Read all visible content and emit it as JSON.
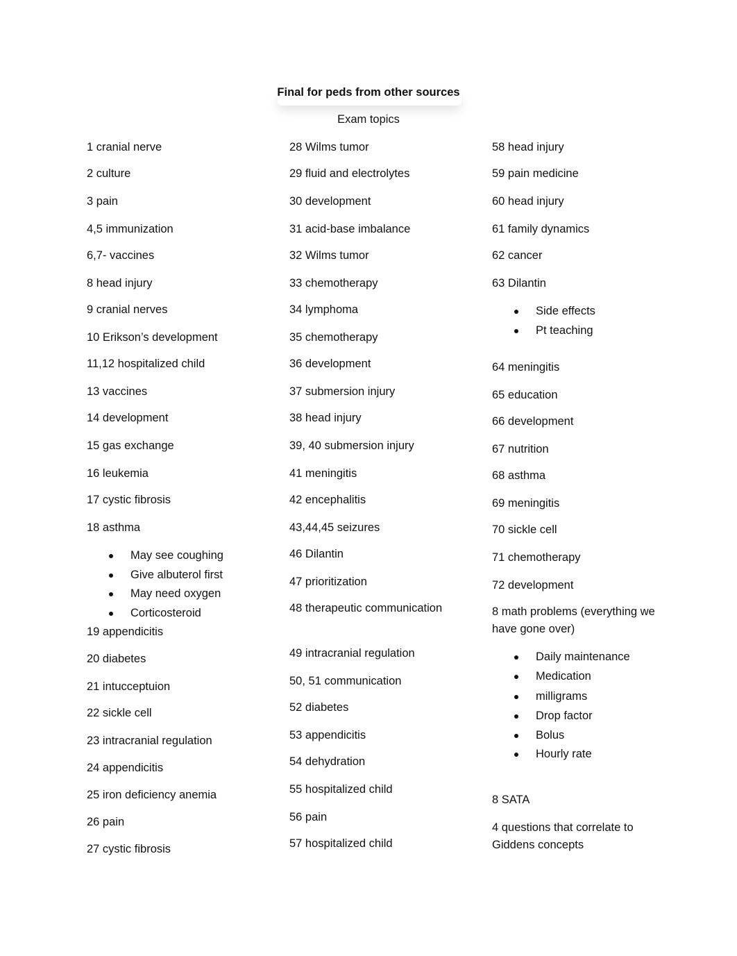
{
  "document": {
    "title": "Final for peds from other sources",
    "subtitle": "Exam topics"
  },
  "columns": [
    {
      "items": [
        {
          "type": "item",
          "text": "1 cranial nerve"
        },
        {
          "type": "item",
          "text": "2 culture"
        },
        {
          "type": "item",
          "text": "3 pain"
        },
        {
          "type": "item",
          "text": "4,5 immunization"
        },
        {
          "type": "item",
          "text": "6,7- vaccines"
        },
        {
          "type": "item",
          "text": "8 head injury"
        },
        {
          "type": "item",
          "text": "9 cranial nerves"
        },
        {
          "type": "item",
          "text": "10 Erikson’s development"
        },
        {
          "type": "item",
          "text": "11,12 hospitalized child"
        },
        {
          "type": "item",
          "text": "13 vaccines"
        },
        {
          "type": "item",
          "text": "14 development"
        },
        {
          "type": "item",
          "text": "15 gas exchange"
        },
        {
          "type": "item",
          "text": "16 leukemia"
        },
        {
          "type": "item",
          "text": "17 cystic fibrosis"
        },
        {
          "type": "item",
          "text": "18 asthma"
        },
        {
          "type": "bullet",
          "text": "May see coughing"
        },
        {
          "type": "bullet",
          "text": "Give albuterol first"
        },
        {
          "type": "bullet",
          "text": "May need oxygen"
        },
        {
          "type": "bullet",
          "text": "Corticosteroid"
        },
        {
          "type": "item",
          "text": "19 appendicitis"
        },
        {
          "type": "item",
          "text": "20 diabetes"
        },
        {
          "type": "item",
          "text": "21 intucceptuion"
        },
        {
          "type": "item",
          "text": "22 sickle cell"
        },
        {
          "type": "item",
          "text": "23 intracranial regulation"
        },
        {
          "type": "item",
          "text": "24 appendicitis"
        },
        {
          "type": "item",
          "text": "25 iron deficiency anemia"
        },
        {
          "type": "item",
          "text": "26 pain"
        },
        {
          "type": "item",
          "text": "27 cystic fibrosis"
        }
      ]
    },
    {
      "items": [
        {
          "type": "item",
          "text": "28 Wilms tumor"
        },
        {
          "type": "item",
          "text": "29 fluid and electrolytes"
        },
        {
          "type": "item",
          "text": "30 development"
        },
        {
          "type": "item",
          "text": "31 acid-base imbalance"
        },
        {
          "type": "item",
          "text": "32 Wilms tumor"
        },
        {
          "type": "item",
          "text": "33 chemotherapy"
        },
        {
          "type": "item",
          "text": "34 lymphoma"
        },
        {
          "type": "item",
          "text": "35 chemotherapy"
        },
        {
          "type": "item",
          "text": "36 development"
        },
        {
          "type": "item",
          "text": "37 submersion injury"
        },
        {
          "type": "item",
          "text": "38 head injury"
        },
        {
          "type": "item",
          "text": "39, 40 submersion injury"
        },
        {
          "type": "item",
          "text": "41 meningitis"
        },
        {
          "type": "item",
          "text": "42 encephalitis"
        },
        {
          "type": "item",
          "text": "43,44,45 seizures"
        },
        {
          "type": "item",
          "text": "46 Dilantin"
        },
        {
          "type": "item",
          "text": "47 prioritization"
        },
        {
          "type": "item",
          "text": "48 therapeutic communication"
        },
        {
          "type": "item",
          "text": "49 intracranial regulation"
        },
        {
          "type": "item",
          "text": "50, 51 communication"
        },
        {
          "type": "item",
          "text": "52 diabetes"
        },
        {
          "type": "item",
          "text": "53 appendicitis"
        },
        {
          "type": "item",
          "text": "54 dehydration"
        },
        {
          "type": "item",
          "text": "55 hospitalized child"
        },
        {
          "type": "item",
          "text": "56 pain"
        },
        {
          "type": "item",
          "text": "57 hospitalized child"
        }
      ]
    },
    {
      "items": [
        {
          "type": "item",
          "text": "58 head injury"
        },
        {
          "type": "item",
          "text": "59 pain medicine"
        },
        {
          "type": "item",
          "text": "60 head injury"
        },
        {
          "type": "item",
          "text": "61 family dynamics"
        },
        {
          "type": "item",
          "text": "62 cancer"
        },
        {
          "type": "item",
          "text": "63 Dilantin"
        },
        {
          "type": "bullet",
          "text": "Side effects"
        },
        {
          "type": "bullet",
          "text": "Pt teaching"
        },
        {
          "type": "item",
          "text": "64 meningitis"
        },
        {
          "type": "item",
          "text": "65 education"
        },
        {
          "type": "item",
          "text": "66 development"
        },
        {
          "type": "item",
          "text": "67 nutrition"
        },
        {
          "type": "item",
          "text": "68 asthma"
        },
        {
          "type": "item",
          "text": "69 meningitis"
        },
        {
          "type": "item",
          "text": "70 sickle cell"
        },
        {
          "type": "item",
          "text": "71 chemotherapy"
        },
        {
          "type": "item",
          "text": "72 development"
        },
        {
          "type": "item",
          "text": "8 math problems (everything we have gone over)"
        },
        {
          "type": "bullet",
          "text": "Daily maintenance"
        },
        {
          "type": "bullet",
          "text": "Medication"
        },
        {
          "type": "bullet",
          "text": "milligrams"
        },
        {
          "type": "bullet",
          "text": "Drop factor"
        },
        {
          "type": "bullet",
          "text": "Bolus"
        },
        {
          "type": "bullet",
          "text": "Hourly rate"
        },
        {
          "type": "item",
          "text": "8 SATA"
        },
        {
          "type": "item",
          "text": "4 questions that correlate to Giddens concepts"
        }
      ]
    }
  ]
}
